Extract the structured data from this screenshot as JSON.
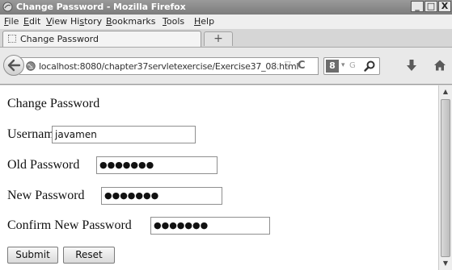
{
  "window": {
    "title": "Change Password - Mozilla Firefox",
    "minimize_glyph": "_",
    "maximize_glyph": "□",
    "close_glyph": "X"
  },
  "menu": {
    "items": [
      {
        "prefix": "",
        "u": "F",
        "rest": "ile"
      },
      {
        "prefix": "",
        "u": "E",
        "rest": "dit"
      },
      {
        "prefix": "",
        "u": "V",
        "rest": "iew"
      },
      {
        "prefix": "Hi",
        "u": "s",
        "rest": "tory"
      },
      {
        "prefix": "",
        "u": "B",
        "rest": "ookmarks"
      },
      {
        "prefix": "",
        "u": "T",
        "rest": "ools"
      },
      {
        "prefix": "",
        "u": "H",
        "rest": "elp"
      }
    ]
  },
  "tabs": {
    "active_title": "Change Password",
    "new_tab_glyph": "+"
  },
  "navbar": {
    "url": "localhost:8080/chapter37servletexercise/Exercise37_08.html",
    "search_engine_glyph": "8",
    "search_placeholder": "G",
    "star_glyph": "☆",
    "dropdown_glyph": "▽",
    "reload_glyph": "C",
    "search_drop_glyph": "▾"
  },
  "form": {
    "heading": "Change Password",
    "username_label": "Username",
    "username_value": "javamen",
    "old_password_label": "Old Password",
    "old_password_mask": "●●●●●●●",
    "new_password_label": "New Password",
    "new_password_mask": "●●●●●●●",
    "confirm_password_label": "Confirm New Password",
    "confirm_password_mask": "●●●●●●●",
    "submit_label": "Submit",
    "reset_label": "Reset"
  },
  "scrollbar": {
    "up_glyph": "▲",
    "down_glyph": "▼"
  },
  "icons": {
    "app": "firefox-icon",
    "tab": "page-icon",
    "back": "back-arrow-icon",
    "site": "globe-icon",
    "search": "magnifier-icon",
    "download": "download-arrow-icon",
    "home": "home-icon"
  }
}
